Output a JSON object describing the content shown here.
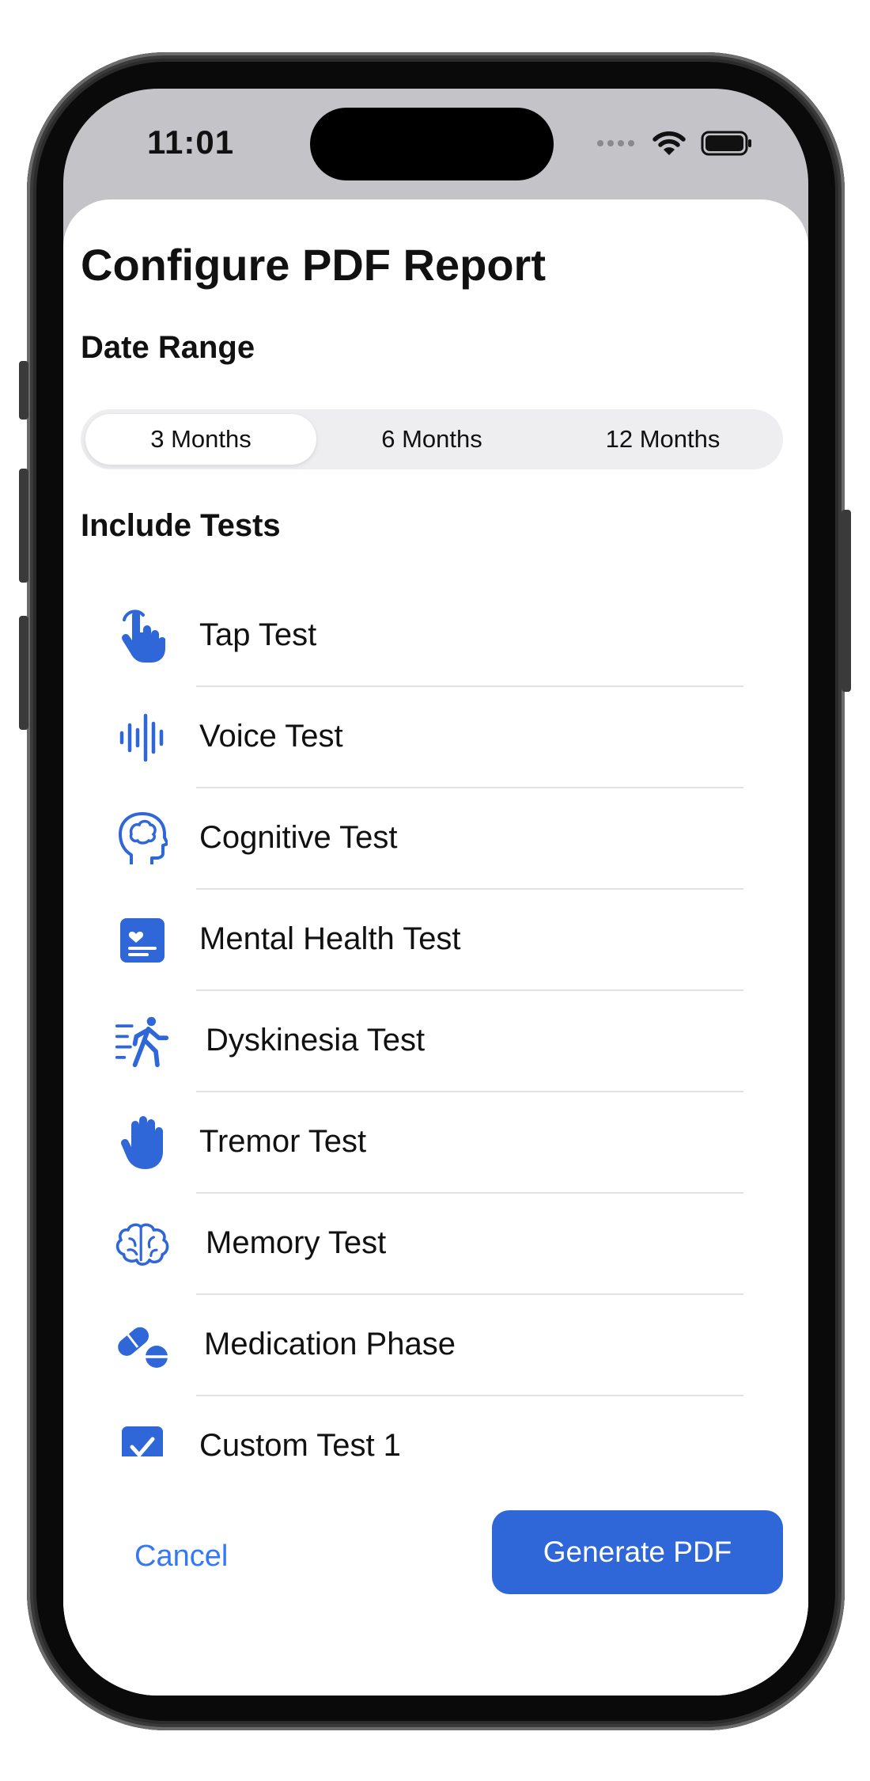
{
  "status_bar": {
    "time": "11:01",
    "icons": [
      "signal-dots-icon",
      "wifi-icon",
      "battery-icon"
    ]
  },
  "sheet": {
    "title": "Configure PDF Report"
  },
  "date_range": {
    "heading": "Date Range",
    "options": [
      "3 Months",
      "6 Months",
      "12 Months"
    ],
    "selected": "3 Months"
  },
  "tests": {
    "heading": "Include Tests",
    "items": [
      {
        "label": "Tap Test",
        "icon": "hand-tap-icon"
      },
      {
        "label": "Voice Test",
        "icon": "waveform-icon"
      },
      {
        "label": "Cognitive Test",
        "icon": "head-brain-icon"
      },
      {
        "label": "Mental Health Test",
        "icon": "heart-text-square-icon"
      },
      {
        "label": "Dyskinesia Test",
        "icon": "figure-walk-motion-icon"
      },
      {
        "label": "Tremor Test",
        "icon": "hand-raised-icon"
      },
      {
        "label": "Memory Test",
        "icon": "brain-icon"
      },
      {
        "label": "Medication Phase",
        "icon": "pills-icon"
      },
      {
        "label": "Custom Test 1",
        "icon": "checkmark-square-icon"
      }
    ]
  },
  "footer": {
    "cancel_label": "Cancel",
    "generate_label": "Generate PDF"
  },
  "colors": {
    "accent": "#2f66d8",
    "link": "#3478f6",
    "status_bar_bg": "#c4c4c8"
  }
}
